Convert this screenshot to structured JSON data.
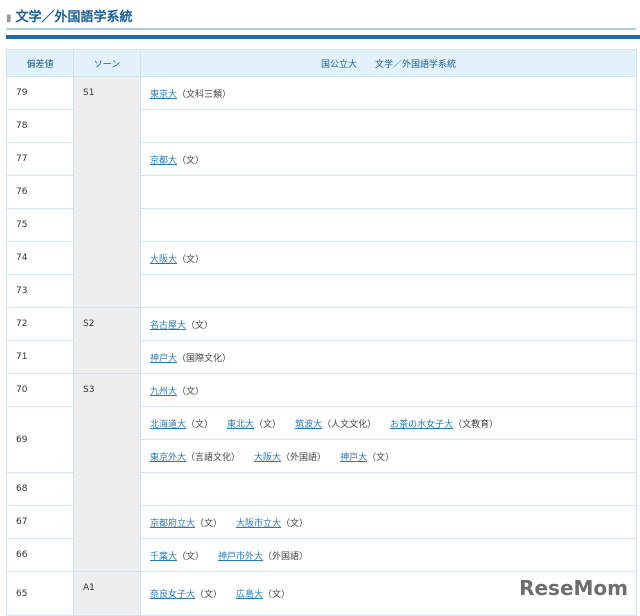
{
  "title": "文学／外国語学系統",
  "header": {
    "score": "偏差値",
    "zone": "ソーン",
    "univ": "国公立大　　文学／外国語学系統"
  },
  "rows": [
    {
      "score": "79",
      "zone": "S1",
      "entries": [
        {
          "name": "東京大",
          "dept": "（文科三類）"
        }
      ]
    },
    {
      "score": "78",
      "entries": []
    },
    {
      "score": "77",
      "entries": [
        {
          "name": "京都大",
          "dept": "（文）"
        }
      ]
    },
    {
      "score": "76",
      "entries": []
    },
    {
      "score": "75",
      "entries": []
    },
    {
      "score": "74",
      "entries": [
        {
          "name": "大阪大",
          "dept": "（文）"
        }
      ]
    },
    {
      "score": "73",
      "entries": []
    },
    {
      "score": "72",
      "zone": "S2",
      "entries": [
        {
          "name": "名古屋大",
          "dept": "（文）"
        }
      ]
    },
    {
      "score": "71",
      "entries": [
        {
          "name": "神戸大",
          "dept": "（国際文化）"
        }
      ]
    },
    {
      "score": "70",
      "zone": "S3",
      "entries": [
        {
          "name": "九州大",
          "dept": "（文）"
        }
      ]
    },
    {
      "score": "69",
      "entries": [
        {
          "name": "北海道大",
          "dept": "（文）"
        },
        {
          "name": "東北大",
          "dept": "（文）"
        },
        {
          "name": "筑波大",
          "dept": "（人文文化）"
        },
        {
          "name": "お茶の水女子大",
          "dept": "（文教育）"
        }
      ],
      "entries2": [
        {
          "name": "東京外大",
          "dept": "（言語文化）"
        },
        {
          "name": "大阪大",
          "dept": "（外国語）"
        },
        {
          "name": "神戸大",
          "dept": "（文）"
        }
      ]
    },
    {
      "score": "68",
      "entries": []
    },
    {
      "score": "67",
      "entries": [
        {
          "name": "京都府立大",
          "dept": "（文）"
        },
        {
          "name": "大阪市立大",
          "dept": "（文）"
        }
      ]
    },
    {
      "score": "66",
      "entries": [
        {
          "name": "千葉大",
          "dept": "（文）"
        },
        {
          "name": "神戸市外大",
          "dept": "（外国語）"
        }
      ]
    },
    {
      "score": "65",
      "zone": "A1",
      "entries": [
        {
          "name": "奈良女子大",
          "dept": "（文）"
        },
        {
          "name": "広島大",
          "dept": "（文）"
        }
      ]
    }
  ],
  "watermark": "ReseMom"
}
